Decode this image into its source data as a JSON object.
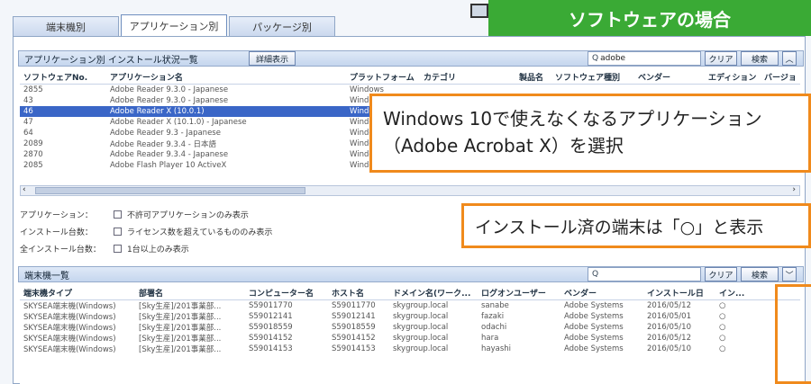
{
  "tabs": [
    {
      "label": "端末機別"
    },
    {
      "label": "アプリケーション別"
    },
    {
      "label": "パッケージ別"
    }
  ],
  "banner": "ソフトウェアの場合",
  "app_panel": {
    "title": "アプリケーション別 インストール状況一覧",
    "detail_button": "詳細表示",
    "search_value": "adobe",
    "clear_button": "クリア",
    "search_button": "検索",
    "columns": [
      "ソフトウェアNo.",
      "アプリケーション名",
      "プラットフォーム",
      "カテゴリ",
      "製品名",
      "ソフトウェア種別",
      "ベンダー",
      "エディション",
      "バージョン"
    ],
    "rows": [
      {
        "no": "2855",
        "name": "Adobe Reader 9.3.0 - Japanese",
        "platform": "Windows",
        "selected": false
      },
      {
        "no": "43",
        "name": "Adobe Reader 9.3.0 - Japanese",
        "platform": "Windows",
        "selected": false
      },
      {
        "no": "46",
        "name": "Adobe Reader X (10.0.1)",
        "platform": "Windows",
        "selected": true
      },
      {
        "no": "47",
        "name": "Adobe Reader X (10.1.0) - Japanese",
        "platform": "Windows",
        "selected": false
      },
      {
        "no": "64",
        "name": "Adobe Reader 9.3 - Japanese",
        "platform": "Windows",
        "selected": false
      },
      {
        "no": "2089",
        "name": "Adobe Reader 9.3.4 - 日本語",
        "platform": "Windows",
        "selected": false
      },
      {
        "no": "2870",
        "name": "Adobe Reader 9.3.4 - Japanese",
        "platform": "Windows",
        "selected": false
      },
      {
        "no": "2085",
        "name": "Adobe Flash Player 10 ActiveX",
        "platform": "Windows",
        "selected": false
      }
    ]
  },
  "filters": [
    {
      "label": "アプリケーション：",
      "option": "不許可アプリケーションのみ表示"
    },
    {
      "label": "インストール台数：",
      "option": "ライセンス数を超えているもののみ表示"
    },
    {
      "label": "全インストール台数：",
      "option": "1台以上のみ表示"
    }
  ],
  "device_panel": {
    "title": "端末機一覧",
    "search_placeholder": "Q",
    "clear_button": "クリア",
    "search_button": "検索",
    "columns": [
      "端末機タイプ",
      "部署名",
      "コンピューター名",
      "ホスト名",
      "ドメイン名(ワーク...",
      "ログオンユーザー",
      "ベンダー",
      "インストール日",
      "イン..."
    ],
    "rows": [
      {
        "type": "SKYSEA端末機(Windows)",
        "dept": "[Sky生産]/201事業部...",
        "computer": "S59011770",
        "host": "S59011770",
        "domain": "skygroup.local",
        "user": "sanabe",
        "vendor": "Adobe Systems",
        "date": "2016/05/12",
        "installed": "○"
      },
      {
        "type": "SKYSEA端末機(Windows)",
        "dept": "[Sky生産]/201事業部...",
        "computer": "S59012141",
        "host": "S59012141",
        "domain": "skygroup.local",
        "user": "fazaki",
        "vendor": "Adobe Systems",
        "date": "2016/05/01",
        "installed": "○"
      },
      {
        "type": "SKYSEA端末機(Windows)",
        "dept": "[Sky生産]/201事業部...",
        "computer": "S59018559",
        "host": "S59018559",
        "domain": "skygroup.local",
        "user": "odachi",
        "vendor": "Adobe Systems",
        "date": "2016/05/10",
        "installed": "○"
      },
      {
        "type": "SKYSEA端末機(Windows)",
        "dept": "[Sky生産]/201事業部...",
        "computer": "S59014152",
        "host": "S59014152",
        "domain": "skygroup.local",
        "user": "hara",
        "vendor": "Adobe Systems",
        "date": "2016/05/12",
        "installed": "○"
      },
      {
        "type": "SKYSEA端末機(Windows)",
        "dept": "[Sky生産]/201事業部...",
        "computer": "S59014153",
        "host": "S59014153",
        "domain": "skygroup.local",
        "user": "hayashi",
        "vendor": "Adobe Systems",
        "date": "2016/05/10",
        "installed": "○"
      }
    ]
  },
  "callouts": {
    "line1": "Windows 10で使えなくなるアプリケーション",
    "line2": "（Adobe Acrobat X）を選択",
    "install_note": "インストール済の端末は「○」と表示"
  },
  "colors": {
    "banner": "#3aaa35",
    "callout_border": "#f08a1c",
    "selection": "#3a66c7"
  }
}
